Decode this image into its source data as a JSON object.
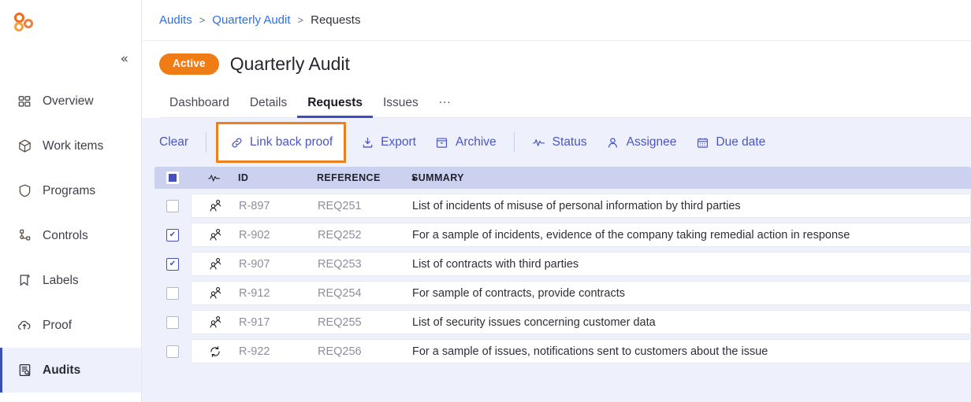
{
  "brand": {
    "logo_name": "three-circles-logo",
    "accent_orange": "#ef6c1a",
    "accent_blue": "#4b55c4",
    "highlight_orange": "#ef7f1a"
  },
  "sidebar": {
    "collapse_label": "«",
    "items": [
      {
        "label": "Overview",
        "icon": "dashboard-icon",
        "active": false
      },
      {
        "label": "Work items",
        "icon": "box-icon",
        "active": false
      },
      {
        "label": "Programs",
        "icon": "shield-icon",
        "active": false
      },
      {
        "label": "Controls",
        "icon": "sitemap-icon",
        "active": false
      },
      {
        "label": "Labels",
        "icon": "bookmark-icon",
        "active": false
      },
      {
        "label": "Proof",
        "icon": "cloud-up-icon",
        "active": false
      },
      {
        "label": "Audits",
        "icon": "audit-doc-icon",
        "active": true
      }
    ]
  },
  "breadcrumb": {
    "items": [
      "Audits",
      "Quarterly Audit",
      "Requests"
    ],
    "separator": ">"
  },
  "header": {
    "status_badge": "Active",
    "title": "Quarterly Audit",
    "tabs": [
      {
        "label": "Dashboard",
        "active": false
      },
      {
        "label": "Details",
        "active": false
      },
      {
        "label": "Requests",
        "active": true
      },
      {
        "label": "Issues",
        "active": false
      },
      {
        "label": "...",
        "active": false
      }
    ]
  },
  "toolbar": {
    "clear_label": "Clear",
    "link_back_proof_label": "Link back proof",
    "export_label": "Export",
    "archive_label": "Archive",
    "status_label": "Status",
    "assignee_label": "Assignee",
    "due_date_label": "Due date"
  },
  "table": {
    "select_all_state": "indeterminate",
    "columns": {
      "status": "",
      "id": "ID",
      "reference": "REFERENCE",
      "summary": "SUMMARY"
    },
    "sort": {
      "column": "REFERENCE",
      "direction": "asc",
      "caret": "▲"
    },
    "rows": [
      {
        "checked": false,
        "status_icon": "assignee-icon",
        "id": "R-897",
        "reference": "REQ251",
        "summary": "List of incidents of misuse of personal information by third parties"
      },
      {
        "checked": true,
        "status_icon": "assignee-icon",
        "id": "R-902",
        "reference": "REQ252",
        "summary": "For a sample of incidents, evidence of the company taking remedial action in response"
      },
      {
        "checked": true,
        "status_icon": "assignee-icon",
        "id": "R-907",
        "reference": "REQ253",
        "summary": "List of contracts with third parties"
      },
      {
        "checked": false,
        "status_icon": "assignee-icon",
        "id": "R-912",
        "reference": "REQ254",
        "summary": "For sample of contracts, provide contracts"
      },
      {
        "checked": false,
        "status_icon": "assignee-icon",
        "id": "R-917",
        "reference": "REQ255",
        "summary": "List of security issues concerning customer data"
      },
      {
        "checked": false,
        "status_icon": "refresh-icon",
        "id": "R-922",
        "reference": "REQ256",
        "summary": "For a sample of issues, notifications sent to customers about the issue"
      }
    ]
  }
}
